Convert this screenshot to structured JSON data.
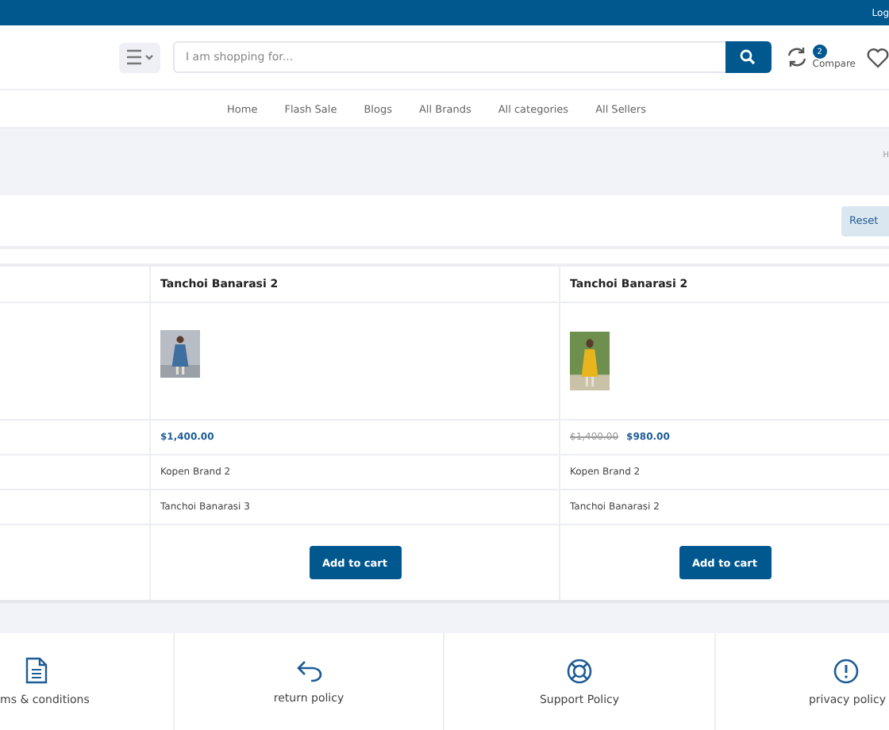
{
  "top_bar": {
    "link": "Log"
  },
  "header": {
    "search": {
      "placeholder": "I am shopping for..."
    },
    "compare": {
      "count": "2",
      "label": "Compare"
    }
  },
  "nav": [
    "Home",
    "Flash Sale",
    "Blogs",
    "All Brands",
    "All categories",
    "All Sellers"
  ],
  "banner": {
    "breadcrumb": "H"
  },
  "reset_button": "Reset",
  "compare_table": {
    "products": [
      {
        "name": "Tanchoi Banarasi 2",
        "price": "$1,400.00",
        "brand": "Kopen Brand 2",
        "model": "Tanchoi Banarasi 3",
        "button": "Add to cart"
      },
      {
        "name": "Tanchoi Banarasi 2",
        "old_price": "$1,400.00",
        "price": "$980.00",
        "brand": "Kopen Brand 2",
        "model": "Tanchoi Banarasi 2",
        "button": "Add to cart"
      }
    ]
  },
  "policies": [
    {
      "kind": "document",
      "label": "ms & conditions"
    },
    {
      "kind": "return",
      "label": "return policy"
    },
    {
      "kind": "support",
      "label": "Support Policy"
    },
    {
      "kind": "info",
      "label": "privacy policy"
    }
  ]
}
